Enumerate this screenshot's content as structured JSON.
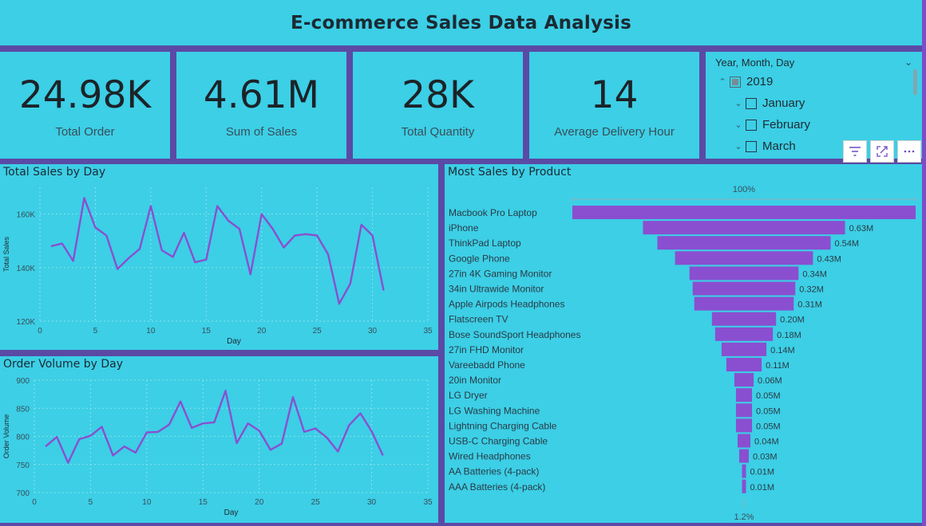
{
  "header": {
    "title": "E-commerce Sales Data Analysis"
  },
  "kpis": [
    {
      "value": "24.98K",
      "label": "Total Order"
    },
    {
      "value": "4.61M",
      "label": "Sum of Sales"
    },
    {
      "value": "28K",
      "label": "Total Quantity"
    },
    {
      "value": "14",
      "label": "Average Delivery Hour"
    }
  ],
  "slicer": {
    "title": "Year, Month, Day",
    "year": "2019",
    "months": [
      "January",
      "February",
      "March"
    ]
  },
  "colors": {
    "background": "#3ccfe6",
    "frame": "#5b4aa5",
    "accent": "#8a4fd0"
  },
  "charts": {
    "sales_by_day_title": "Total Sales by Day",
    "order_volume_title": "Order Volume by Day",
    "most_sales_title": "Most Sales by Product"
  },
  "chart_data": [
    {
      "type": "line",
      "title": "Total Sales by Day",
      "xlabel": "Day",
      "ylabel": "Total Sales",
      "x": [
        1,
        2,
        3,
        4,
        5,
        6,
        7,
        8,
        9,
        10,
        11,
        12,
        13,
        14,
        15,
        16,
        17,
        18,
        19,
        20,
        21,
        22,
        23,
        24,
        25,
        26,
        27,
        28,
        29,
        30,
        31
      ],
      "series": [
        {
          "values": [
            148000,
            149000,
            142500,
            166000,
            155000,
            152000,
            139500,
            143500,
            147000,
            163000,
            146500,
            144000,
            153000,
            142000,
            143000,
            163000,
            157500,
            154500,
            137500,
            160000,
            154500,
            147500,
            152000,
            152500,
            152000,
            145000,
            126500,
            134000,
            156000,
            152000,
            131500
          ]
        }
      ],
      "xlim": [
        0,
        35
      ],
      "ylim": [
        120000,
        170000
      ],
      "x_ticks": [
        "0",
        "5",
        "10",
        "15",
        "20",
        "25",
        "30",
        "35"
      ],
      "y_ticks": [
        "120K",
        "140K",
        "160K"
      ],
      "grid": true
    },
    {
      "type": "line",
      "title": "Order Volume by Day",
      "xlabel": "Day",
      "ylabel": "Order Volume",
      "x": [
        1,
        2,
        3,
        4,
        5,
        6,
        7,
        8,
        9,
        10,
        11,
        12,
        13,
        14,
        15,
        16,
        17,
        18,
        19,
        20,
        21,
        22,
        23,
        24,
        25,
        26,
        27,
        28,
        29,
        30,
        31
      ],
      "series": [
        {
          "values": [
            782,
            799,
            753,
            795,
            801,
            817,
            766,
            782,
            771,
            807,
            808,
            821,
            862,
            815,
            823,
            825,
            881,
            788,
            823,
            810,
            776,
            787,
            870,
            808,
            814,
            798,
            773,
            820,
            841,
            809,
            766
          ]
        }
      ],
      "xlim": [
        0,
        35
      ],
      "ylim": [
        700,
        900
      ],
      "x_ticks": [
        "0",
        "5",
        "10",
        "15",
        "20",
        "25",
        "30",
        "35"
      ],
      "y_ticks": [
        "700",
        "750",
        "800",
        "850",
        "900"
      ],
      "grid": true
    },
    {
      "type": "bar",
      "title": "Most Sales by Product",
      "orientation": "funnel",
      "categories": [
        "Macbook Pro Laptop",
        "iPhone",
        "ThinkPad Laptop",
        "Google Phone",
        "27in 4K Gaming Monitor",
        "34in Ultrawide Monitor",
        "Apple Airpods Headphones",
        "Flatscreen TV",
        "Bose SoundSport Headphones",
        "27in FHD Monitor",
        "Vareebadd Phone",
        "20in Monitor",
        "LG Dryer",
        "LG Washing Machine",
        "Lightning Charging Cable",
        "USB-C Charging Cable",
        "Wired Headphones",
        "AA Batteries (4-pack)",
        "AAA Batteries (4-pack)"
      ],
      "values": [
        1.07,
        0.63,
        0.54,
        0.43,
        0.34,
        0.32,
        0.31,
        0.2,
        0.18,
        0.14,
        0.11,
        0.06,
        0.05,
        0.05,
        0.05,
        0.04,
        0.03,
        0.01,
        0.01
      ],
      "value_labels": [
        "",
        "0.63M",
        "0.54M",
        "0.43M",
        "0.34M",
        "0.32M",
        "0.31M",
        "0.20M",
        "0.18M",
        "0.14M",
        "0.11M",
        "0.06M",
        "0.05M",
        "0.05M",
        "0.05M",
        "0.04M",
        "0.03M",
        "0.01M",
        "0.01M"
      ],
      "top_percent": "100%",
      "bottom_percent": "1.2%"
    }
  ]
}
